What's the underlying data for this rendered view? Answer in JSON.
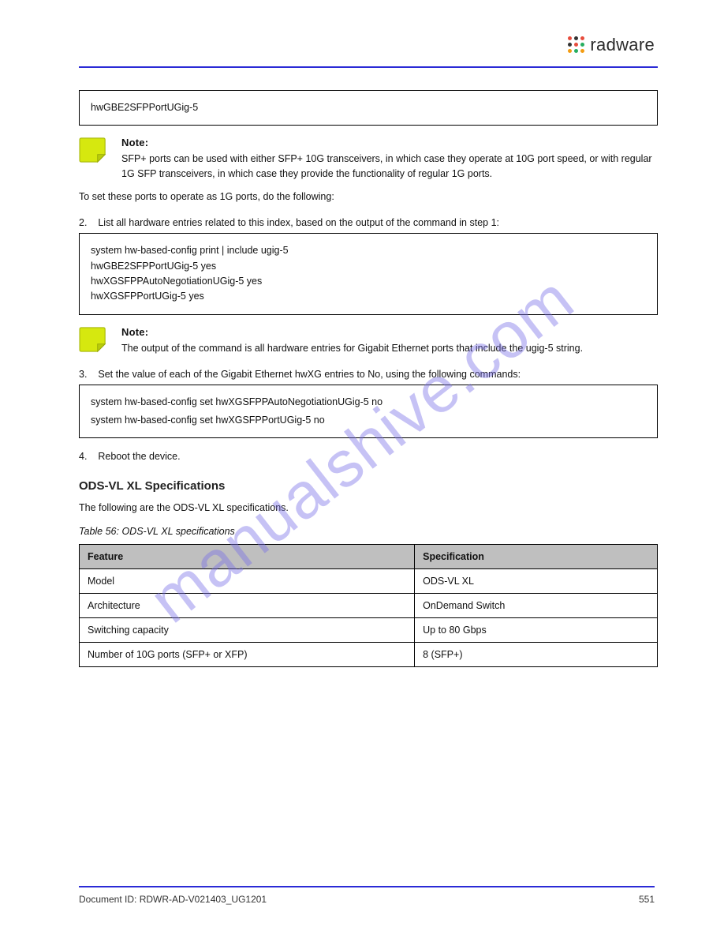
{
  "brand": {
    "name": "radware"
  },
  "watermark": "manualshive.com",
  "codebox1": {
    "line1": "hwGBE2SFPPortUGig-5"
  },
  "note1": {
    "title": "Note:",
    "body": "SFP+ ports can be used with either SFP+ 10G transceivers, in which case they operate at 10G port speed, or with regular 1G SFP transceivers, in which case they provide the functionality of regular 1G ports."
  },
  "para1": "To set these ports to operate as 1G ports, do the following:",
  "step2": {
    "label": "2.",
    "text": "List all hardware entries related to this index, based on the output of the command in step 1:"
  },
  "codebox2": {
    "line1": "system hw-based-config print | include ugig-5",
    "line2": "hwGBE2SFPPortUGig-5    yes",
    "line3": "hwXGSFPPAutoNegotiationUGig-5  yes",
    "line4": "hwXGSFPPortUGig-5    yes"
  },
  "note2": {
    "title": "Note:",
    "body": "The output of the command is all hardware entries for Gigabit Ethernet ports that include the ugig-5 string."
  },
  "step3": {
    "label": "3.",
    "text": "Set the value of each of the Gigabit Ethernet hwXG entries to No, using the following commands:"
  },
  "codebox3": {
    "line1": "system hw-based-config set hwXGSFPPAutoNegotiationUGig-5 no",
    "line2": "system hw-based-config set hwXGSFPPortUGig-5 no"
  },
  "step4": {
    "label": "4.",
    "text": "Reboot the device."
  },
  "section": {
    "title": "ODS-VL XL Specifications",
    "intro": "The following are the ODS-VL XL specifications.",
    "tablecaption": "Table 56: ODS-VL XL specifications"
  },
  "table": {
    "headers": {
      "feature": "Feature",
      "spec": "Specification"
    },
    "rows": [
      {
        "feature": "Model",
        "spec": "ODS-VL XL"
      },
      {
        "feature": "Architecture",
        "spec": "OnDemand Switch"
      },
      {
        "feature": "Switching capacity",
        "spec": "Up to 80 Gbps"
      },
      {
        "feature": "Number of 10G ports (SFP+ or XFP)",
        "spec": "8 (SFP+)"
      }
    ]
  },
  "footer": {
    "left": "Document ID: RDWR-AD-V021403_UG1201",
    "right": "551"
  }
}
